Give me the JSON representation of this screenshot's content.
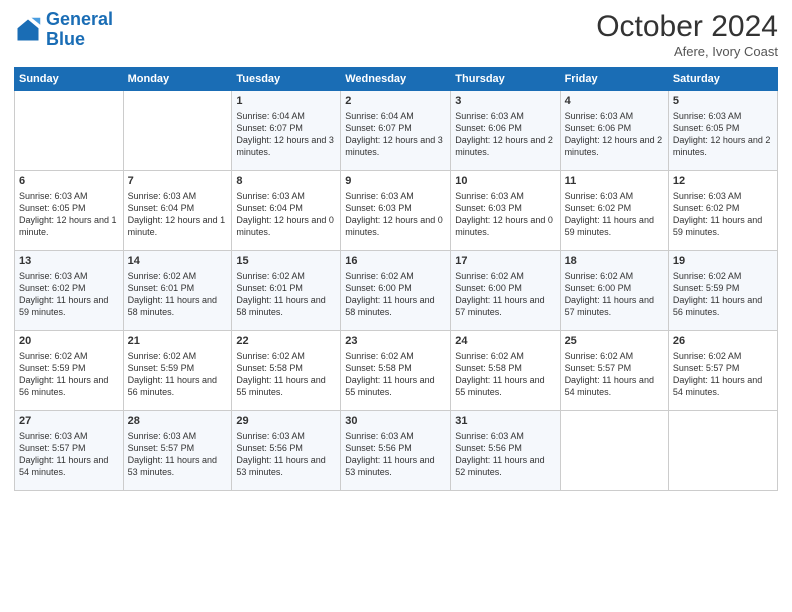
{
  "logo": {
    "line1": "General",
    "line2": "Blue"
  },
  "header": {
    "title": "October 2024",
    "subtitle": "Afere, Ivory Coast"
  },
  "columns": [
    "Sunday",
    "Monday",
    "Tuesday",
    "Wednesday",
    "Thursday",
    "Friday",
    "Saturday"
  ],
  "weeks": [
    [
      {
        "day": "",
        "content": ""
      },
      {
        "day": "",
        "content": ""
      },
      {
        "day": "1",
        "content": "Sunrise: 6:04 AM\nSunset: 6:07 PM\nDaylight: 12 hours and 3 minutes."
      },
      {
        "day": "2",
        "content": "Sunrise: 6:04 AM\nSunset: 6:07 PM\nDaylight: 12 hours and 3 minutes."
      },
      {
        "day": "3",
        "content": "Sunrise: 6:03 AM\nSunset: 6:06 PM\nDaylight: 12 hours and 2 minutes."
      },
      {
        "day": "4",
        "content": "Sunrise: 6:03 AM\nSunset: 6:06 PM\nDaylight: 12 hours and 2 minutes."
      },
      {
        "day": "5",
        "content": "Sunrise: 6:03 AM\nSunset: 6:05 PM\nDaylight: 12 hours and 2 minutes."
      }
    ],
    [
      {
        "day": "6",
        "content": "Sunrise: 6:03 AM\nSunset: 6:05 PM\nDaylight: 12 hours and 1 minute."
      },
      {
        "day": "7",
        "content": "Sunrise: 6:03 AM\nSunset: 6:04 PM\nDaylight: 12 hours and 1 minute."
      },
      {
        "day": "8",
        "content": "Sunrise: 6:03 AM\nSunset: 6:04 PM\nDaylight: 12 hours and 0 minutes."
      },
      {
        "day": "9",
        "content": "Sunrise: 6:03 AM\nSunset: 6:03 PM\nDaylight: 12 hours and 0 minutes."
      },
      {
        "day": "10",
        "content": "Sunrise: 6:03 AM\nSunset: 6:03 PM\nDaylight: 12 hours and 0 minutes."
      },
      {
        "day": "11",
        "content": "Sunrise: 6:03 AM\nSunset: 6:02 PM\nDaylight: 11 hours and 59 minutes."
      },
      {
        "day": "12",
        "content": "Sunrise: 6:03 AM\nSunset: 6:02 PM\nDaylight: 11 hours and 59 minutes."
      }
    ],
    [
      {
        "day": "13",
        "content": "Sunrise: 6:03 AM\nSunset: 6:02 PM\nDaylight: 11 hours and 59 minutes."
      },
      {
        "day": "14",
        "content": "Sunrise: 6:02 AM\nSunset: 6:01 PM\nDaylight: 11 hours and 58 minutes."
      },
      {
        "day": "15",
        "content": "Sunrise: 6:02 AM\nSunset: 6:01 PM\nDaylight: 11 hours and 58 minutes."
      },
      {
        "day": "16",
        "content": "Sunrise: 6:02 AM\nSunset: 6:00 PM\nDaylight: 11 hours and 58 minutes."
      },
      {
        "day": "17",
        "content": "Sunrise: 6:02 AM\nSunset: 6:00 PM\nDaylight: 11 hours and 57 minutes."
      },
      {
        "day": "18",
        "content": "Sunrise: 6:02 AM\nSunset: 6:00 PM\nDaylight: 11 hours and 57 minutes."
      },
      {
        "day": "19",
        "content": "Sunrise: 6:02 AM\nSunset: 5:59 PM\nDaylight: 11 hours and 56 minutes."
      }
    ],
    [
      {
        "day": "20",
        "content": "Sunrise: 6:02 AM\nSunset: 5:59 PM\nDaylight: 11 hours and 56 minutes."
      },
      {
        "day": "21",
        "content": "Sunrise: 6:02 AM\nSunset: 5:59 PM\nDaylight: 11 hours and 56 minutes."
      },
      {
        "day": "22",
        "content": "Sunrise: 6:02 AM\nSunset: 5:58 PM\nDaylight: 11 hours and 55 minutes."
      },
      {
        "day": "23",
        "content": "Sunrise: 6:02 AM\nSunset: 5:58 PM\nDaylight: 11 hours and 55 minutes."
      },
      {
        "day": "24",
        "content": "Sunrise: 6:02 AM\nSunset: 5:58 PM\nDaylight: 11 hours and 55 minutes."
      },
      {
        "day": "25",
        "content": "Sunrise: 6:02 AM\nSunset: 5:57 PM\nDaylight: 11 hours and 54 minutes."
      },
      {
        "day": "26",
        "content": "Sunrise: 6:02 AM\nSunset: 5:57 PM\nDaylight: 11 hours and 54 minutes."
      }
    ],
    [
      {
        "day": "27",
        "content": "Sunrise: 6:03 AM\nSunset: 5:57 PM\nDaylight: 11 hours and 54 minutes."
      },
      {
        "day": "28",
        "content": "Sunrise: 6:03 AM\nSunset: 5:57 PM\nDaylight: 11 hours and 53 minutes."
      },
      {
        "day": "29",
        "content": "Sunrise: 6:03 AM\nSunset: 5:56 PM\nDaylight: 11 hours and 53 minutes."
      },
      {
        "day": "30",
        "content": "Sunrise: 6:03 AM\nSunset: 5:56 PM\nDaylight: 11 hours and 53 minutes."
      },
      {
        "day": "31",
        "content": "Sunrise: 6:03 AM\nSunset: 5:56 PM\nDaylight: 11 hours and 52 minutes."
      },
      {
        "day": "",
        "content": ""
      },
      {
        "day": "",
        "content": ""
      }
    ]
  ]
}
